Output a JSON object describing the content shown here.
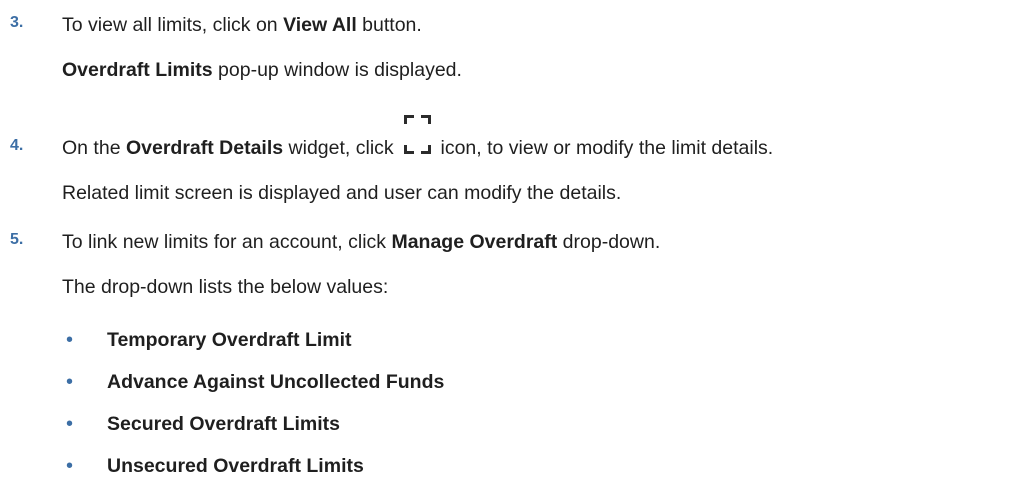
{
  "steps": [
    {
      "number": "3.",
      "pre": "To view all limits, click on ",
      "bold": "View All",
      "post": " button.",
      "result_bold": "Overdraft Limits",
      "result_post": " pop-up window is displayed."
    },
    {
      "number": "4.",
      "pre": "On the ",
      "bold": "Overdraft Details",
      "mid": " widget, click ",
      "icon": "expand-icon",
      "post": " icon, to view or modify the limit details.",
      "result": "Related limit screen is displayed and user can modify the details."
    },
    {
      "number": "5.",
      "pre": "To link new limits for an account, click ",
      "bold": "Manage Overdraft",
      "post": " drop-down.",
      "result": "The drop-down lists the below values:",
      "options": [
        "Temporary Overdraft Limit",
        "Advance Against Uncollected Funds",
        "Secured Overdraft Limits",
        "Unsecured Overdraft Limits"
      ]
    }
  ],
  "bullet_char": "•",
  "colors": {
    "accent": "#3c6ea5",
    "text": "#1f1f1f"
  }
}
